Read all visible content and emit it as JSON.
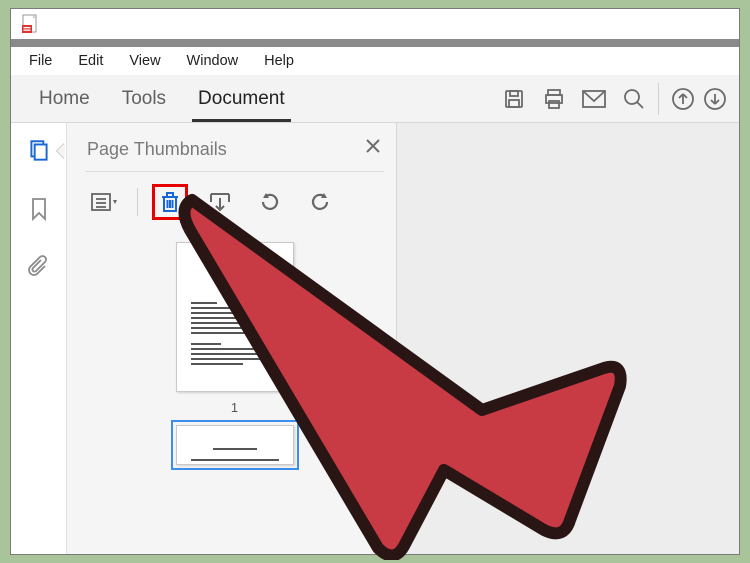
{
  "menu": {
    "file": "File",
    "edit": "Edit",
    "view": "View",
    "window": "Window",
    "help": "Help"
  },
  "tabs": {
    "home": "Home",
    "tools": "Tools",
    "document": "Document"
  },
  "panel": {
    "title": "Page Thumbnails"
  },
  "thumbs": {
    "page1_label": "1"
  }
}
